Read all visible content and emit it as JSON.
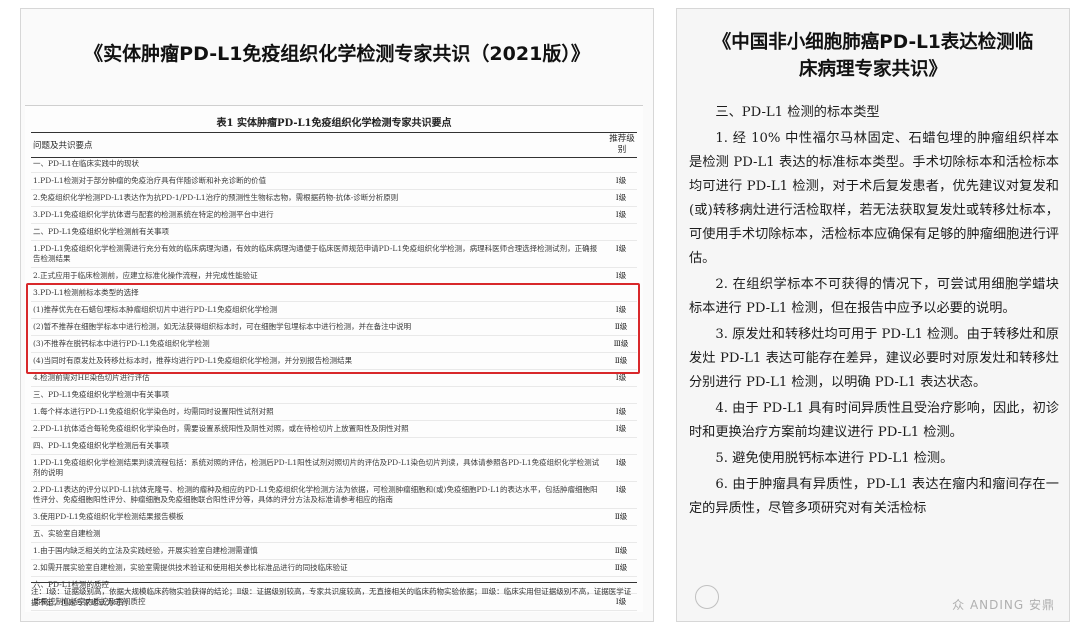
{
  "left_panel": {
    "title": "《实体肿瘤PD-L1免疫组织化学检测专家共识（2021版）》",
    "table": {
      "caption": "表1  实体肿瘤PD-L1免疫组织化学检测专家共识要点",
      "header_col1": "问题及共识要点",
      "header_col2": "推荐级别",
      "rows": [
        {
          "text": "一、PD-L1在临床实践中的现状",
          "grade": ""
        },
        {
          "text": "1.PD-L1检测对于部分肿瘤的免疫治疗具有伴随诊断和补充诊断的价值",
          "grade": "Ⅰ级"
        },
        {
          "text": "2.免疫组织化学检测PD-L1表达作为抗PD-1/PD-L1治疗的预测性生物标志物，需根据药物-抗体-诊断分析原则",
          "grade": "Ⅰ级"
        },
        {
          "text": "3.PD-L1免疫组织化学抗体谱与配套的检测系统在特定的检测平台中进行",
          "grade": "Ⅰ级"
        },
        {
          "text": "二、PD-L1免疫组织化学检测前有关事项",
          "grade": ""
        },
        {
          "text": "1.PD-L1免疫组织化学检测需进行充分有效的临床病理沟通，有效的临床病理沟通便于临床医师规范申请PD-L1免疫组织化学检测，病理科医师合理选择检测试剂，正确报告检测结果",
          "grade": "Ⅰ级"
        },
        {
          "text": "2.正式应用于临床检测前，应建立标准化操作流程，并完成性能验证",
          "grade": "Ⅰ级"
        },
        {
          "text": "3.PD-L1检测前标本类型的选择",
          "grade": ""
        },
        {
          "text": "(1)推荐优先在石蜡包埋标本肿瘤组织切片中进行PD-L1免疫组织化学检测",
          "grade": "Ⅰ级"
        },
        {
          "text": "(2)暂不推荐在细胞学标本中进行检测，如无法获得组织标本时，可在细胞学包埋标本中进行检测，并在备注中说明",
          "grade": "Ⅱ级"
        },
        {
          "text": "(3)不推荐在脱钙标本中进行PD-L1免疫组织化学检测",
          "grade": "Ⅲ级"
        },
        {
          "text": "(4)当同时有原发灶及转移灶标本时，推荐均进行PD-L1免疫组织化学检测，并分别报告检测结果",
          "grade": "Ⅱ级"
        },
        {
          "text": "4.检测前需对HE染色切片进行评估",
          "grade": "Ⅰ级"
        },
        {
          "text": "三、PD-L1免疫组织化学检测中有关事项",
          "grade": ""
        },
        {
          "text": "1.每个样本进行PD-L1免疫组织化学染色时，均需同时设置阳性试剂对照",
          "grade": "Ⅰ级"
        },
        {
          "text": "2.PD-L1抗体适合每轮免疫组织化学染色时，需要设置系统阳性及阴性对照，或在待检切片上放置阳性及阴性对照",
          "grade": "Ⅰ级"
        },
        {
          "text": "四、PD-L1免疫组织化学检测后有关事项",
          "grade": ""
        },
        {
          "text": "1.PD-L1免疫组织化学检测结果判读流程包括：系统对照的评估，检测后PD-L1阳性试剂对照切片的评估及PD-L1染色切片判读，具体请参照各PD-L1免疫组织化学检测试剂的说明",
          "grade": "Ⅰ级"
        },
        {
          "text": "2.PD-L1表达的评分以PD-L1抗体克隆号、检测的瘤种及相应的PD-L1免疫组织化学检测方法为依据，可检测肿瘤细胞和(或)免疫细胞PD-L1的表达水平，包括肿瘤细胞阳性评分、免疫细胞阳性评分、肿瘤细胞及免疫细胞联合阳性评分等，具体的评分方法及标准请参考相应的指南",
          "grade": "Ⅰ级"
        },
        {
          "text": "3.使用PD-L1免疫组织化学检测结果报告模板",
          "grade": "Ⅱ级"
        },
        {
          "text": "五、实验室自建检测",
          "grade": ""
        },
        {
          "text": "1.由于国内缺乏相关的立法及实践经验，开展实验室自建检测需谨慎",
          "grade": "Ⅱ级"
        },
        {
          "text": "2.如需开展实验室自建检测，实验室需提供技术验证和使用相关参比标准品进行的同技临床验证",
          "grade": "Ⅱ级"
        },
        {
          "text": "六、PD-L1检测的质控",
          "grade": ""
        },
        {
          "text": "质量控制包括室内质控及室间质控",
          "grade": "Ⅰ级"
        }
      ],
      "footnote": "注：Ⅰ级：证据级别高，依据大规模临床药物实验获得的结论；Ⅱ级：证据级别较高，专家共识度较高，无直接相关的临床药物实验依据；Ⅲ级：临床实用但证据级别不高，证据医学证据不足，但是专家组认为可行"
    }
  },
  "right_panel": {
    "title_line1": "《中国非小细胞肺癌PD-L1表达检测临",
    "title_line2": "床病理专家共识》",
    "paragraphs": [
      "三、PD-L1 检测的标本类型",
      "1. 经 10% 中性福尔马林固定、石蜡包埋的肿瘤组织样本是检测 PD-L1 表达的标准标本类型。手术切除标本和活检标本均可进行 PD-L1 检测，对于术后复发患者，优先建议对复发和(或)转移病灶进行活检取样，若无法获取复发灶或转移灶标本，可使用手术切除标本，活检标本应确保有足够的肿瘤细胞进行评估。",
      "2. 在组织学标本不可获得的情况下，可尝试用细胞学蜡块标本进行 PD-L1 检测，但在报告中应予以必要的说明。",
      "3. 原发灶和转移灶均可用于 PD-L1 检测。由于转移灶和原发灶 PD-L1 表达可能存在差异，建议必要时对原发灶和转移灶分别进行 PD-L1 检测，以明确 PD-L1 表达状态。",
      "4. 由于 PD-L1 具有时间异质性且受治疗影响，因此，初诊时和更换治疗方案前均建议进行 PD-L1 检测。",
      "5. 避免使用脱钙标本进行 PD-L1 检测。",
      "6. 由于肿瘤具有异质性，PD-L1 表达在瘤内和瘤间存在一定的异质性，尽管多项研究对有关活检标"
    ],
    "watermark": "众 ANDING 安鼎"
  },
  "colors": {
    "highlight": "#d8282b",
    "text": "#1c1c1c"
  }
}
